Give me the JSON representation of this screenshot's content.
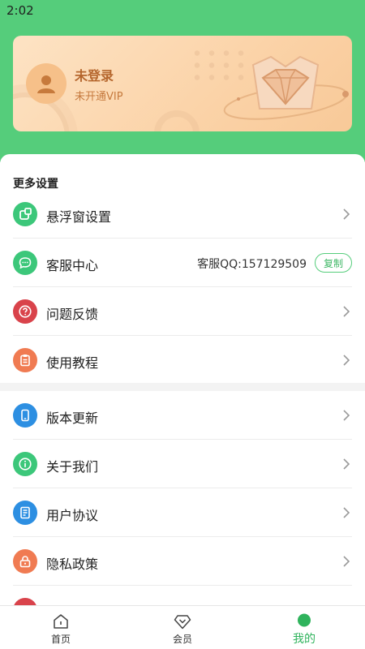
{
  "status_bar": {
    "time": "2:02"
  },
  "profile": {
    "login_title": "未登录",
    "vip_status": "未开通VIP"
  },
  "more_settings": {
    "title": "更多设置",
    "items": [
      {
        "label": "悬浮窗设置",
        "icon": "floating-window-icon",
        "color": "#3cc77a"
      },
      {
        "label": "客服中心",
        "icon": "chat-icon",
        "color": "#3cc77a",
        "qq": "客服QQ:157129509",
        "copy_label": "复制"
      },
      {
        "label": "问题反馈",
        "icon": "question-icon",
        "color": "#d9434b"
      },
      {
        "label": "使用教程",
        "icon": "clipboard-icon",
        "color": "#f07b52"
      }
    ]
  },
  "other_items": [
    {
      "label": "版本更新",
      "icon": "phone-icon",
      "color": "#2d8fe2"
    },
    {
      "label": "关于我们",
      "icon": "info-icon",
      "color": "#3cc77a"
    },
    {
      "label": "用户协议",
      "icon": "document-icon",
      "color": "#2d8fe2"
    },
    {
      "label": "隐私政策",
      "icon": "lock-icon",
      "color": "#f07b52"
    }
  ],
  "tabs": [
    {
      "label": "首页",
      "icon": "home-icon",
      "active": false
    },
    {
      "label": "会员",
      "icon": "diamond-icon",
      "active": false
    },
    {
      "label": "我的",
      "icon": "profile-icon",
      "active": true
    }
  ],
  "colors": {
    "primary": "#55cd7b",
    "vip_gold": "#b5662d"
  }
}
